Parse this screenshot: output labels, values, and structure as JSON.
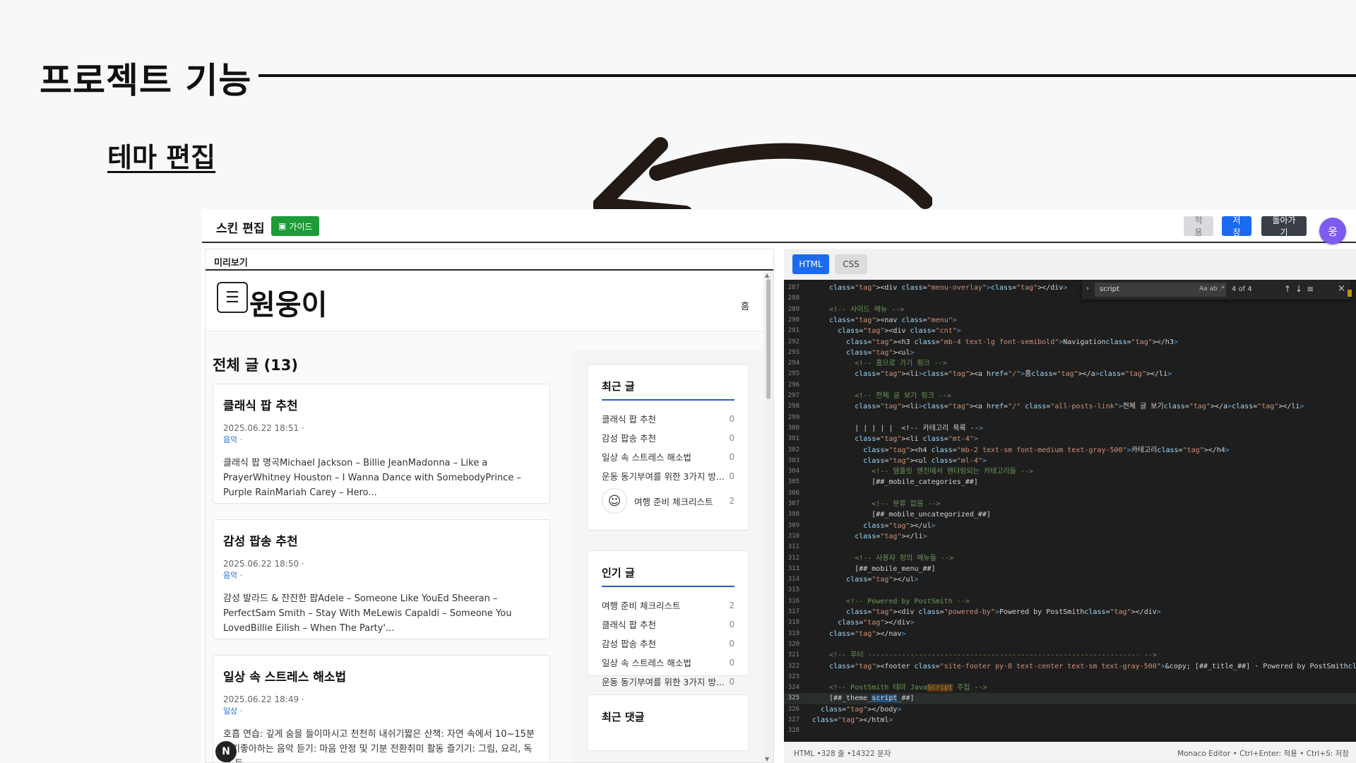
{
  "slide": {
    "title": "프로젝트 기능",
    "subtitle": "테마 편집"
  },
  "topbar": {
    "brand": "스킨 편집",
    "guide": "가이드",
    "apply": "적용",
    "save": "저장",
    "back": "돌아가기",
    "avatar": "웅"
  },
  "preview": {
    "label": "미리보기",
    "blog_title": "원웅이",
    "home": "홈",
    "posts_heading": "전체 글 (13)",
    "posts": [
      {
        "title": "클래식 팝 추천",
        "date": "2025.06.22 18:51 ·",
        "category": "음악 ·",
        "excerpt": "클래식 팝 명곡Michael Jackson – Billie JeanMadonna – Like a PrayerWhitney Houston – I Wanna Dance with SomebodyPrince – Purple RainMariah Carey – Hero..."
      },
      {
        "title": "감성 팝송 추천",
        "date": "2025.06.22 18:50 ·",
        "category": "음악 ·",
        "excerpt": "감성 발라드 & 잔잔한 팝Adele – Someone Like YouEd Sheeran – PerfectSam Smith – Stay With MeLewis Capaldi – Someone You LovedBillie Eilish – When The Party'..."
      },
      {
        "title": "일상 속 스트레스 해소법",
        "date": "2025.06.22 18:49 ·",
        "category": "일상 ·",
        "excerpt": "호흡 연습: 깊게 숨을 들이마시고 천천히 내쉬기짧은 산책: 자연 속에서 10~15분 걷기좋아하는 음악 듣기: 마음 안정 및 기분 전환취미 활동 즐기기: 그림, 요리, 독서 등"
      }
    ],
    "recent": {
      "title": "최근 글",
      "items": [
        {
          "name": "클래식 팝 추천",
          "count": "0"
        },
        {
          "name": "감성 팝송 추천",
          "count": "0"
        },
        {
          "name": "일상 속 스트레스 해소법",
          "count": "0"
        },
        {
          "name": "운동 동기부여를 위한 3가지 방...",
          "count": "0"
        },
        {
          "name": "여행 준비 체크리스트",
          "count": "2"
        }
      ]
    },
    "popular": {
      "title": "인기 글",
      "items": [
        {
          "name": "여행 준비 체크리스트",
          "count": "2"
        },
        {
          "name": "클래식 팝 추천",
          "count": "0"
        },
        {
          "name": "감성 팝송 추천",
          "count": "0"
        },
        {
          "name": "일상 속 스트레스 해소법",
          "count": "0"
        },
        {
          "name": "운동 동기부여를 위한 3가지 방...",
          "count": "0"
        }
      ]
    },
    "comments": {
      "title": "최근 댓글"
    },
    "badge": "N"
  },
  "editor": {
    "tabs": [
      "HTML",
      "CSS"
    ],
    "find": {
      "query": "script",
      "options": "Aa ab .*",
      "count": "4 of 4"
    },
    "lines": [
      {
        "n": "287",
        "code": "    <div class=\"menu-overlay\"></div>"
      },
      {
        "n": "288",
        "code": ""
      },
      {
        "n": "289",
        "code": "    <!-- 사이드 메뉴 -->"
      },
      {
        "n": "290",
        "code": "    <nav class=\"menu\">"
      },
      {
        "n": "291",
        "code": "      <div class=\"cnt\">"
      },
      {
        "n": "292",
        "code": "        <h3 class=\"mb-4 text-lg font-semibold\">Navigation</h3>"
      },
      {
        "n": "293",
        "code": "        <ul>"
      },
      {
        "n": "294",
        "code": "          <!-- 홈으로 가기 링크 -->"
      },
      {
        "n": "295",
        "code": "          <li><a href=\"/\">홈</a></li>"
      },
      {
        "n": "296",
        "code": ""
      },
      {
        "n": "297",
        "code": "          <!-- 전체 글 보기 링크 -->"
      },
      {
        "n": "298",
        "code": "          <li><a href=\"/\" class=\"all-posts-link\">전체 글 보기</a></li>"
      },
      {
        "n": "299",
        "code": ""
      },
      {
        "n": "300",
        "code": "          | | | | |  <!-- 카테고리 목록 -->"
      },
      {
        "n": "301",
        "code": "          <li class=\"mt-4\">"
      },
      {
        "n": "302",
        "code": "            <h4 class=\"mb-2 text-sm font-medium text-gray-500\">카테고리</h4>"
      },
      {
        "n": "303",
        "code": "            <ul class=\"ml-4\">"
      },
      {
        "n": "304",
        "code": "              <!-- 템플릿 엔진에서 렌더링되는 카테고리들 -->"
      },
      {
        "n": "305",
        "code": "              [##_mobile_categories_##]"
      },
      {
        "n": "306",
        "code": ""
      },
      {
        "n": "307",
        "code": "              <!-- 분류 없음 -->"
      },
      {
        "n": "308",
        "code": "              [##_mobile_uncategorized_##]"
      },
      {
        "n": "309",
        "code": "            </ul>"
      },
      {
        "n": "310",
        "code": "          </li>"
      },
      {
        "n": "311",
        "code": ""
      },
      {
        "n": "312",
        "code": "          <!-- 사용자 정의 메뉴들 -->"
      },
      {
        "n": "313",
        "code": "          [##_mobile_menu_##]"
      },
      {
        "n": "314",
        "code": "        </ul>"
      },
      {
        "n": "315",
        "code": ""
      },
      {
        "n": "316",
        "code": "        <!-- Powered by PostSmith -->"
      },
      {
        "n": "317",
        "code": "        <div class=\"powered-by\">Powered by PostSmith</div>"
      },
      {
        "n": "318",
        "code": "      </div>"
      },
      {
        "n": "319",
        "code": "    </nav>"
      },
      {
        "n": "320",
        "code": ""
      },
      {
        "n": "321",
        "code": "    <!-- 푸터 ---------------------------------------------------------------- -->"
      },
      {
        "n": "322",
        "code": "    <footer class=\"site-footer py-8 text-center text-sm text-gray-500\">&copy; [##_title_##] · Powered by PostSmith</footer>"
      },
      {
        "n": "323",
        "code": ""
      },
      {
        "n": "324",
        "code": "    <!-- PostSmith 테마 JavaScript 주입 -->"
      },
      {
        "n": "325",
        "code": "    [##_theme_script_##]"
      },
      {
        "n": "326",
        "code": "  </body>"
      },
      {
        "n": "327",
        "code": "</html>"
      },
      {
        "n": "328",
        "code": ""
      }
    ],
    "status_left": "HTML •328 줄 •14322 문자",
    "status_right": "Monaco Editor • Ctrl+Enter: 적용 • Ctrl+S: 저장"
  }
}
